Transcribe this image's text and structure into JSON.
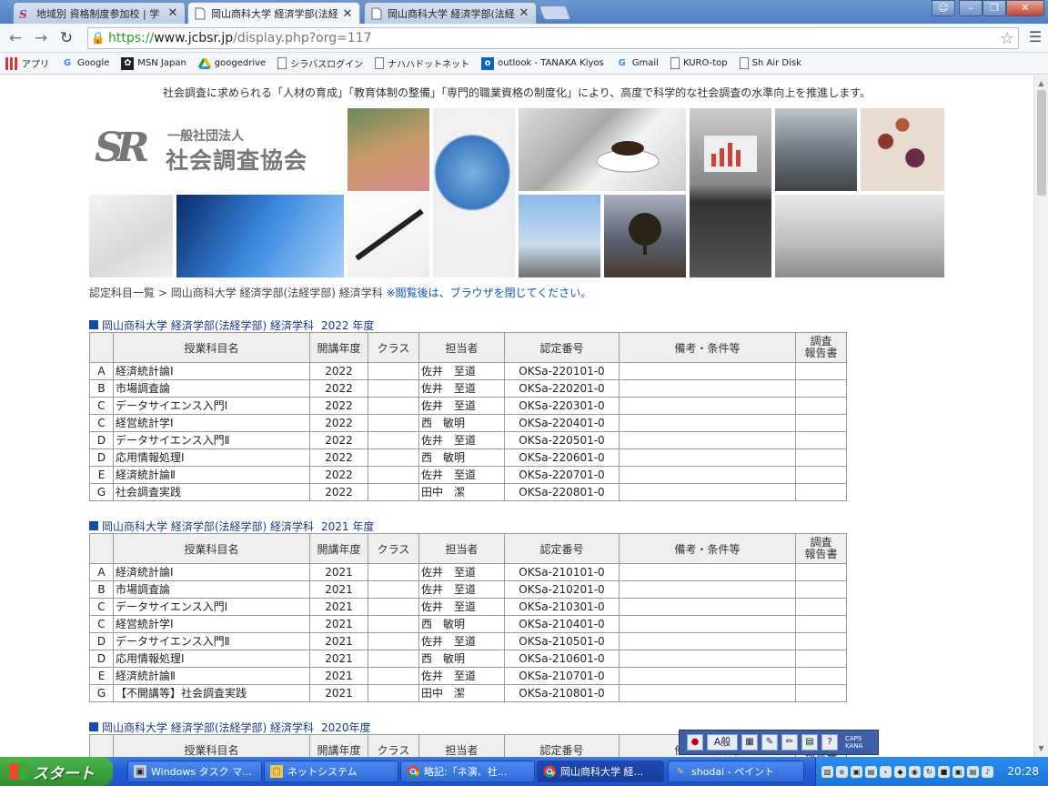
{
  "browser": {
    "tabs": [
      {
        "title": "地域別 資格制度参加校 | 学",
        "favicon": "sr-logo-icon",
        "active": false
      },
      {
        "title": "岡山商科大学 経済学部(法経",
        "favicon": "page-icon",
        "active": true
      },
      {
        "title": "岡山商科大学 経済学部(法経",
        "favicon": "page-icon",
        "active": false
      }
    ],
    "url": {
      "scheme": "https://",
      "host": "www.jcbsr.jp",
      "path": "/display.php?org=117"
    },
    "bookmarks": [
      {
        "label": "アプリ",
        "icon": "apps-grid-icon"
      },
      {
        "label": "Google",
        "icon": "google-icon"
      },
      {
        "label": "MSN Japan",
        "icon": "msn-icon"
      },
      {
        "label": "googedrive",
        "icon": "drive-icon"
      },
      {
        "label": "シラバスログイン",
        "icon": "page-icon"
      },
      {
        "label": "ナハハドットネット",
        "icon": "page-icon"
      },
      {
        "label": "outlook - TANAKA Kiyos",
        "icon": "outlook-icon"
      },
      {
        "label": "Gmail",
        "icon": "google-icon"
      },
      {
        "label": "KURO-top",
        "icon": "page-icon"
      },
      {
        "label": "Sh Air Disk",
        "icon": "page-icon"
      }
    ]
  },
  "page": {
    "tagline": "社会調査に求められる「人材の育成」「教育体制の整備」「専門的職業資格の制度化」により、高度で科学的な社会調査の水準向上を推進します。",
    "logo": {
      "mark": "SR",
      "sub": "一般社団法人",
      "main": "社会調査協会"
    },
    "breadcrumb": {
      "link": "認定科目一覧",
      "sep": " > ",
      "current": "岡山商科大学 経済学部(法経学部) 経済学科",
      "note": "※閲覧後は、ブラウザを閉じてください。"
    },
    "headers": [
      "",
      "授業科目名",
      "開講年度",
      "クラス",
      "担当者",
      "認定番号",
      "備考・条件等",
      "調査\n報告書"
    ],
    "sections": [
      {
        "title": "岡山商科大学 経済学部(法経学部) 経済学科",
        "year": "2022 年度",
        "rows": [
          [
            "A",
            "経済統計論Ⅰ",
            "2022",
            "",
            "佐井　至道",
            "OKSa-220101-0",
            "",
            ""
          ],
          [
            "B",
            "市場調査論",
            "2022",
            "",
            "佐井　至道",
            "OKSa-220201-0",
            "",
            ""
          ],
          [
            "C",
            "データサイエンス入門Ⅰ",
            "2022",
            "",
            "佐井　至道",
            "OKSa-220301-0",
            "",
            ""
          ],
          [
            "C",
            "経営統計学Ⅰ",
            "2022",
            "",
            "西　敏明",
            "OKSa-220401-0",
            "",
            ""
          ],
          [
            "D",
            "データサイエンス入門Ⅱ",
            "2022",
            "",
            "佐井　至道",
            "OKSa-220501-0",
            "",
            ""
          ],
          [
            "D",
            "応用情報処理Ⅰ",
            "2022",
            "",
            "西　敏明",
            "OKSa-220601-0",
            "",
            ""
          ],
          [
            "E",
            "経済統計論Ⅱ",
            "2022",
            "",
            "佐井　至道",
            "OKSa-220701-0",
            "",
            ""
          ],
          [
            "G",
            "社会調査実践",
            "2022",
            "",
            "田中　潔",
            "OKSa-220801-0",
            "",
            ""
          ]
        ]
      },
      {
        "title": "岡山商科大学 経済学部(法経学部) 経済学科",
        "year": "2021 年度",
        "rows": [
          [
            "A",
            "経済統計論Ⅰ",
            "2021",
            "",
            "佐井　至道",
            "OKSa-210101-0",
            "",
            ""
          ],
          [
            "B",
            "市場調査論",
            "2021",
            "",
            "佐井　至道",
            "OKSa-210201-0",
            "",
            ""
          ],
          [
            "C",
            "データサイエンス入門Ⅰ",
            "2021",
            "",
            "佐井　至道",
            "OKSa-210301-0",
            "",
            ""
          ],
          [
            "C",
            "経営統計学Ⅰ",
            "2021",
            "",
            "西　敏明",
            "OKSa-210401-0",
            "",
            ""
          ],
          [
            "D",
            "データサイエンス入門Ⅱ",
            "2021",
            "",
            "佐井　至道",
            "OKSa-210501-0",
            "",
            ""
          ],
          [
            "D",
            "応用情報処理Ⅰ",
            "2021",
            "",
            "西　敏明",
            "OKSa-210601-0",
            "",
            ""
          ],
          [
            "E",
            "経済統計論Ⅱ",
            "2021",
            "",
            "佐井　至道",
            "OKSa-210701-0",
            "",
            ""
          ],
          [
            "G",
            "【不開講等】社会調査実践",
            "2021",
            "",
            "田中　潔",
            "OKSa-210801-0",
            "",
            ""
          ]
        ]
      },
      {
        "title": "岡山商科大学 経済学部(法経学部) 経済学科",
        "year": "2020年度",
        "rows": []
      }
    ]
  },
  "ime": {
    "mode": "A般",
    "caps": "CAPS",
    "kana": "KANA"
  },
  "taskbar": {
    "start": "スタート",
    "tasks": [
      {
        "label": "Windows タスク マ...",
        "icon": "task-manager-icon",
        "active": false
      },
      {
        "label": "ネットシステム",
        "icon": "folder-icon",
        "active": false
      },
      {
        "label": "略記:「ネ演、社...",
        "icon": "chrome-icon",
        "active": false
      },
      {
        "label": "岡山商科大学 経...",
        "icon": "chrome-icon",
        "active": true
      },
      {
        "label": "shodai - ペイント",
        "icon": "paint-icon",
        "active": false
      }
    ],
    "clock": "20:28"
  }
}
